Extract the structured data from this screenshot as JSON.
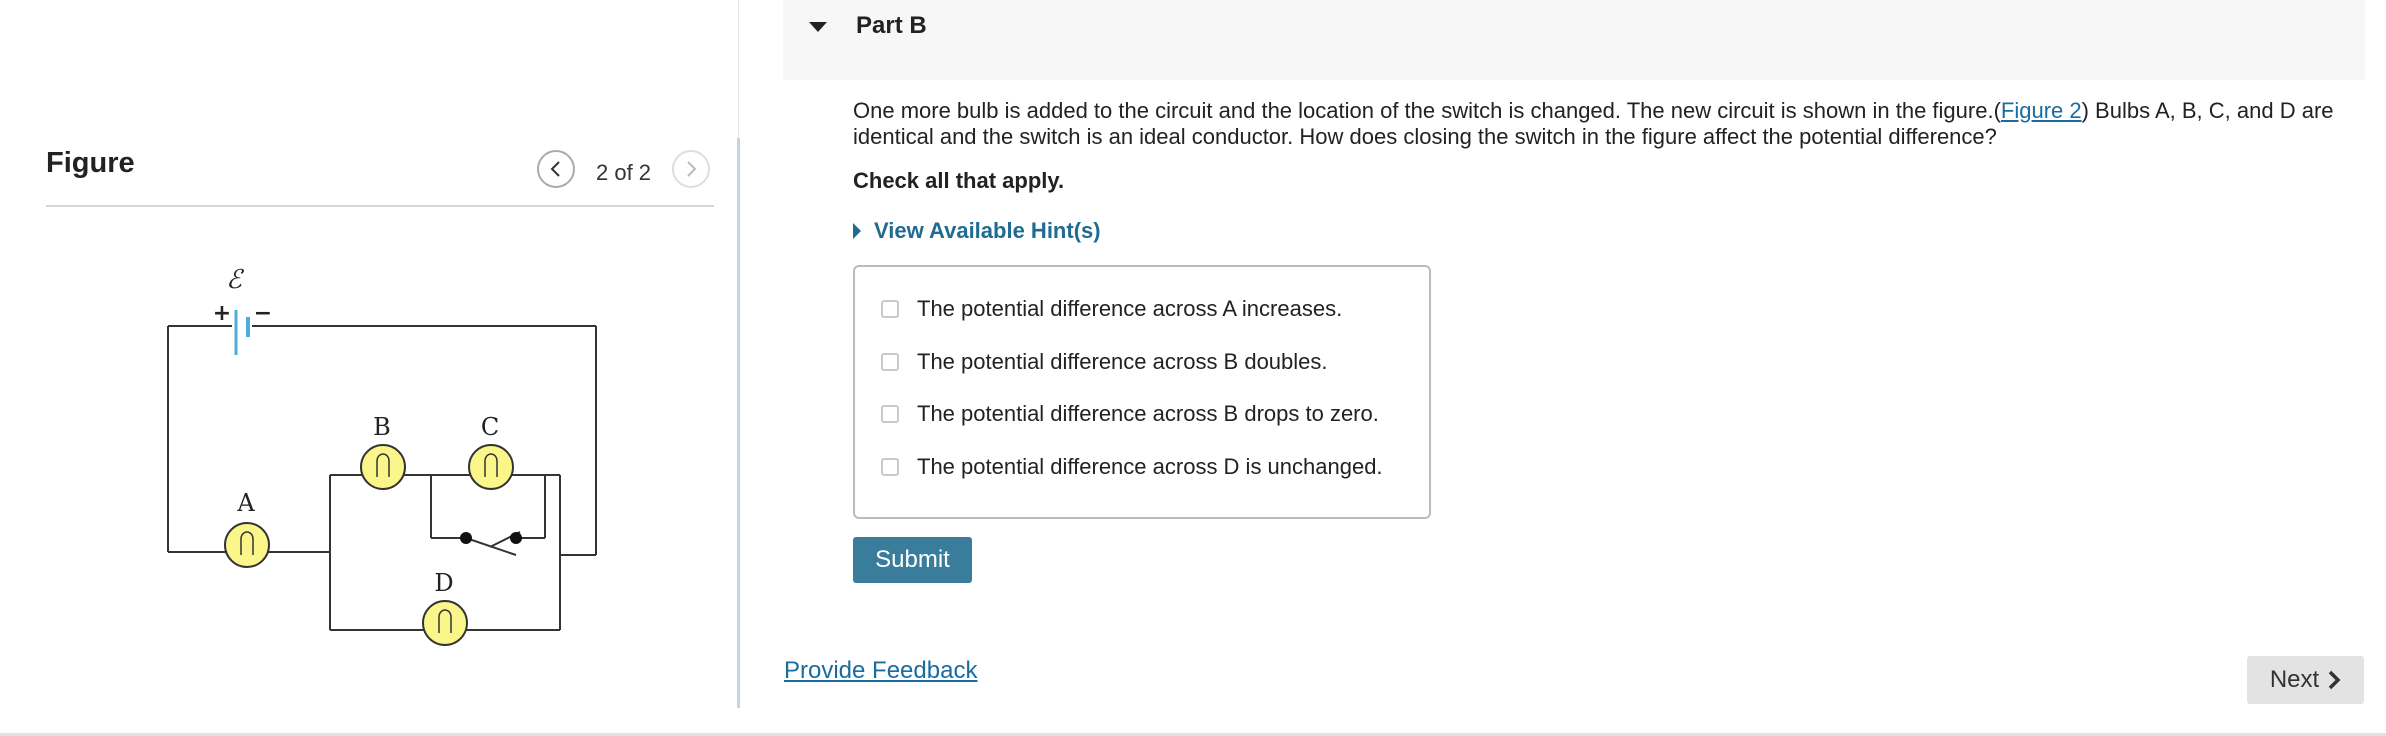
{
  "figure": {
    "title": "Figure",
    "pager": "2 of 2",
    "labels": {
      "emf": "ℰ",
      "plus": "+",
      "minus": "−",
      "a": "A",
      "b": "B",
      "c": "C",
      "d": "D"
    }
  },
  "part": {
    "title": "Part B",
    "question_before": "One more bulb is added to the circuit and the location of the switch is changed. The new circuit is shown in the figure.(",
    "figure_link": "Figure 2",
    "question_after": ") Bulbs A, B, C, and D are identical and the switch is an ideal conductor. How does closing the switch in the figure affect the potential difference?",
    "instruction": "Check all that apply.",
    "hints_label": "View Available Hint(s)",
    "options": [
      "The potential difference across A increases.",
      "The potential difference across B doubles.",
      "The potential difference across B drops to zero.",
      "The potential difference across D is unchanged."
    ],
    "submit_label": "Submit"
  },
  "footer": {
    "feedback_label": "Provide Feedback",
    "next_label": "Next"
  },
  "colors": {
    "link": "#1a6c9e",
    "submit": "#3a7c9c",
    "bulb": "#fbf68a",
    "battery": "#4ab0d8"
  }
}
